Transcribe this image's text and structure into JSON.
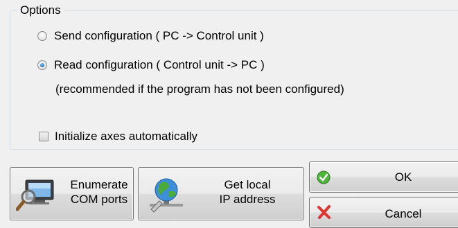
{
  "options": {
    "title": "Options",
    "send_label": "Send configuration ( PC -> Control unit )",
    "send_checked": false,
    "read_label": "Read configuration ( Control unit -> PC )",
    "read_checked": true,
    "read_note": "(recommended if the program has not been configured)",
    "initialize_label": "Initialize axes automatically",
    "initialize_checked": false
  },
  "buttons": {
    "enumerate": {
      "line1": "Enumerate",
      "line2": "COM ports",
      "icon": "computer-magnifier-icon"
    },
    "get_ip": {
      "line1": "Get local",
      "line2": "IP address",
      "icon": "network-globe-icon"
    },
    "ok": {
      "label": "OK",
      "icon": "green-check-icon"
    },
    "cancel": {
      "label": "Cancel",
      "icon": "red-x-icon"
    }
  }
}
